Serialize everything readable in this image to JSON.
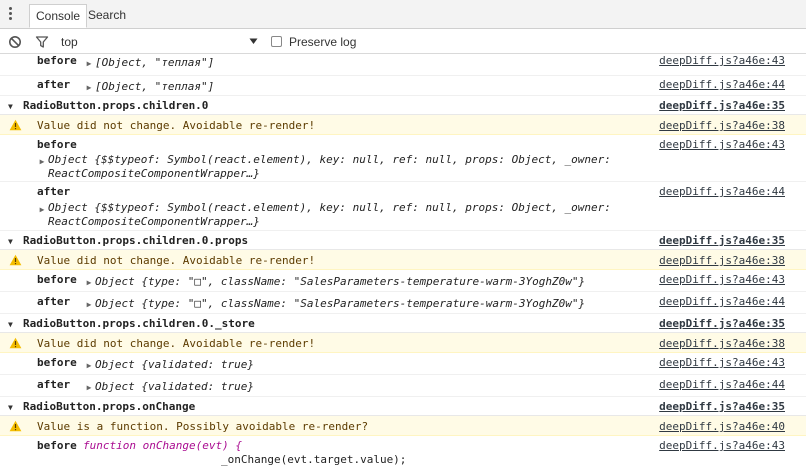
{
  "tabs": [
    "Console",
    "Search"
  ],
  "toolbar": {
    "context": "top",
    "preserve_log": "Preserve log"
  },
  "colors": {
    "warning_bg": "#fffbe6",
    "string": "#c41a16",
    "property": "#881280",
    "literal": "#1a1aa6"
  },
  "log": {
    "r0": {
      "label": "before",
      "value": "[Object, \"теплая\"]",
      "src": "deepDiff.js?a46e:43"
    },
    "r1": {
      "label": "after",
      "value": "[Object, \"теплая\"]",
      "src": "deepDiff.js?a46e:44"
    },
    "g1": {
      "title": "RadioButton.props.children.0",
      "src": "deepDiff.js?a46e:35"
    },
    "w1": {
      "text": "Value did not change. Avoidable re-render!",
      "src": "deepDiff.js?a46e:38"
    },
    "r2": {
      "label": "before",
      "line1": "Object {$$typeof: Symbol(react.element), key: null, ref: null, props: Object, _owner:",
      "line2": "ReactCompositeComponentWrapper…}",
      "src": "deepDiff.js?a46e:43"
    },
    "r3": {
      "label": "after",
      "line1": "Object {$$typeof: Symbol(react.element), key: null, ref: null, props: Object, _owner:",
      "line2": "ReactCompositeComponentWrapper…}",
      "src": "deepDiff.js?a46e:44"
    },
    "g2": {
      "title": "RadioButton.props.children.0.props",
      "src": "deepDiff.js?a46e:35"
    },
    "w2": {
      "text": "Value did not change. Avoidable re-render!",
      "src": "deepDiff.js?a46e:38"
    },
    "r4": {
      "label": "before",
      "value": "Object {type: \"□\", className: \"SalesParameters-temperature-warm-3YoghZ0w\"}",
      "src": "deepDiff.js?a46e:43"
    },
    "r5": {
      "label": "after",
      "value": "Object {type: \"□\", className: \"SalesParameters-temperature-warm-3YoghZ0w\"}",
      "src": "deepDiff.js?a46e:44"
    },
    "g3": {
      "title": "RadioButton.props.children.0._store",
      "src": "deepDiff.js?a46e:35"
    },
    "w3": {
      "text": "Value did not change. Avoidable re-render!",
      "src": "deepDiff.js?a46e:38"
    },
    "r6": {
      "label": "before",
      "value": "Object {validated: true}",
      "src": "deepDiff.js?a46e:43"
    },
    "r7": {
      "label": "after",
      "value": "Object {validated: true}",
      "src": "deepDiff.js?a46e:44"
    },
    "g4": {
      "title": "RadioButton.props.onChange",
      "src": "deepDiff.js?a46e:35"
    },
    "w4": {
      "text": "Value is a function. Possibly avoidable re-render?",
      "src": "deepDiff.js?a46e:40"
    },
    "r8": {
      "label": "before",
      "line1": "function onChange(evt) {",
      "line2": "_onChange(evt.target.value);",
      "src": "deepDiff.js?a46e:43"
    }
  }
}
